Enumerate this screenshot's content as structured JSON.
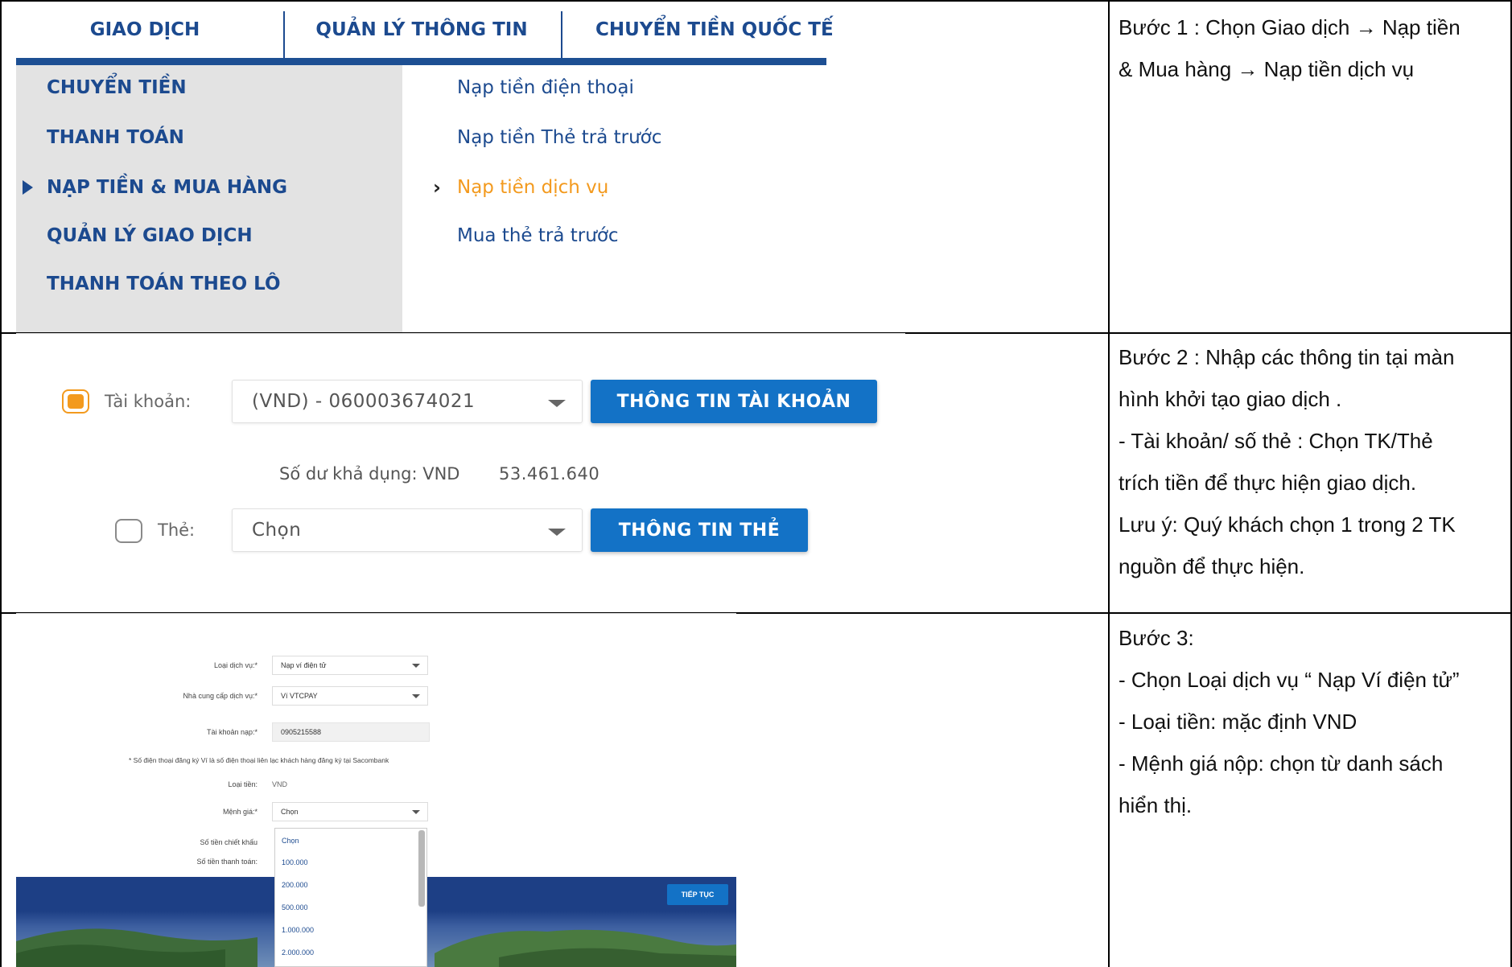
{
  "row1": {
    "tabs": [
      "GIAO DỊCH",
      "QUẢN LÝ THÔNG TIN",
      "CHUYỂN TIỀN QUỐC TẾ"
    ],
    "left_menu": [
      "CHUYỂN TIỀN",
      "THANH TOÁN",
      "NẠP TIỀN & MUA HÀNG",
      "QUẢN LÝ GIAO DỊCH",
      "THANH TOÁN THEO LÔ"
    ],
    "sub_menu": [
      "Nạp tiền điện thoại",
      "Nạp tiền Thẻ trả trước",
      "Nạp tiền dịch vụ",
      "Mua thẻ trả trước"
    ],
    "desc": [
      "Bước 1 : Chọn Giao dịch → Nạp tiền",
      "& Mua hàng → Nạp tiền dịch vụ"
    ]
  },
  "row2": {
    "account_label": "Tài khoản:",
    "account_value": "(VND) - 060003674021",
    "account_button": "THÔNG TIN TÀI KHOẢN",
    "balance_label": "Số dư khả dụng: VND",
    "balance_value": "53.461.640",
    "card_label": "Thẻ:",
    "card_value": "Chọn",
    "card_button": "THÔNG TIN THẺ",
    "desc": [
      "Bước 2 : Nhập các thông tin tại màn",
      "hình khởi tạo giao dịch .",
      "- Tài khoản/ số thẻ : Chọn TK/Thẻ",
      "trích tiền để thực hiện giao dịch.",
      "Lưu ý: Quý khách chọn 1 trong 2 TK",
      "nguồn để thực hiện."
    ]
  },
  "row3": {
    "service_type_label": "Loại dịch vụ:*",
    "service_type_value": "Nạp ví điện tử",
    "provider_label": "Nhà cung cấp dịch vụ:*",
    "provider_value": "Ví VTCPAY",
    "account_label": "Tài khoản nạp:*",
    "account_value": "0905215588",
    "note": "* Số điện thoại đăng ký Ví là số điện thoại liên lạc khách hàng đăng ký tại Sacombank",
    "currency_label": "Loại tiền:",
    "currency_value": "VND",
    "denom_label": "Mệnh giá:*",
    "denom_value": "Chọn",
    "discount_label": "Số tiền chiết khấu",
    "pay_label": "Số tiền thanh toán:",
    "continue_button": "TIẾP TỤC",
    "options": [
      "Chọn",
      "100.000",
      "200.000",
      "500.000",
      "1.000.000",
      "2.000.000"
    ],
    "desc": [
      "Bước 3:",
      "- Chọn Loại dịch vụ “ Nạp Ví điện tử”",
      "- Loại tiền: mặc định VND",
      "- Mệnh giá nộp: chọn từ danh sách",
      "hiển thị."
    ]
  },
  "colors": {
    "brand_blue": "#1c4a8f",
    "button_blue": "#1372c6",
    "active_orange": "#f39a1e"
  }
}
